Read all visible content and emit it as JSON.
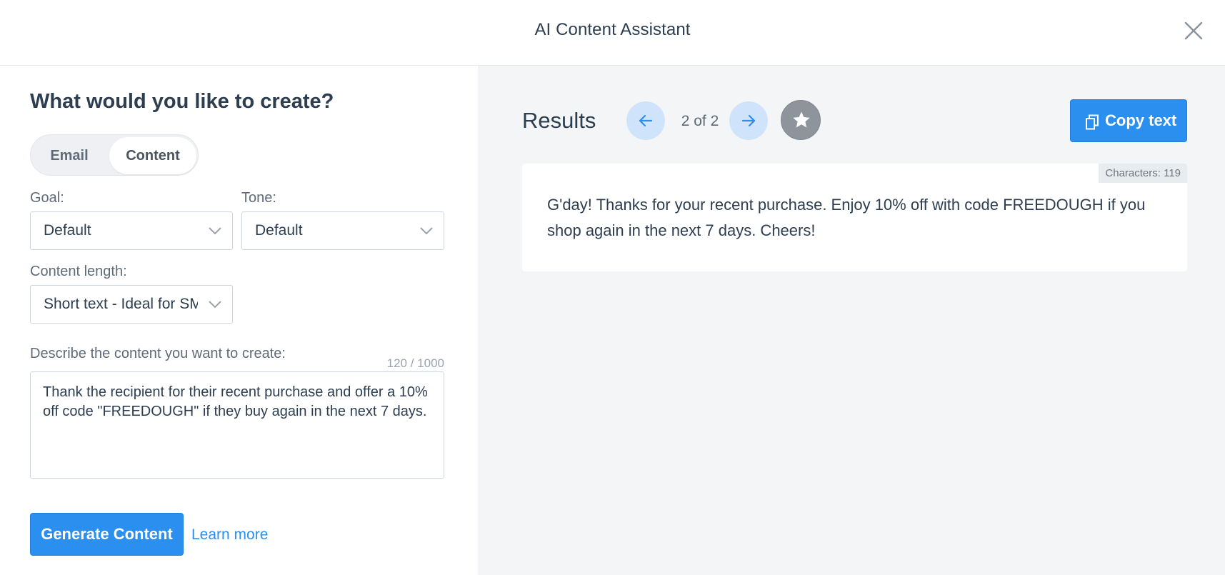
{
  "header": {
    "title": "AI Content Assistant"
  },
  "form": {
    "heading": "What would you like to create?",
    "toggle": {
      "options": [
        "Email",
        "Content"
      ],
      "selected": "Content"
    },
    "goal": {
      "label": "Goal:",
      "value": "Default"
    },
    "tone": {
      "label": "Tone:",
      "value": "Default"
    },
    "length": {
      "label": "Content length:",
      "value": "Short text - Ideal for SMS"
    },
    "description": {
      "label": "Describe the content you want to create:",
      "counter": "120 / 1000",
      "value": "Thank the recipient for their recent purchase and offer a 10% off code \"FREEDOUGH\" if they buy again in the next 7 days."
    },
    "generate_label": "Generate Content",
    "learn_more_label": "Learn more"
  },
  "results": {
    "title": "Results",
    "pager": "2 of 2",
    "copy_label": "Copy text",
    "char_count": "Characters: 119",
    "text": "G'day! Thanks for your recent purchase. Enjoy 10% off with code FREEDOUGH if you shop again in the next 7 days. Cheers!"
  },
  "colors": {
    "accent": "#2b8fef",
    "nav_bg": "#cfe4fa",
    "star_bg": "#8e949c",
    "panel_bg": "#f4f5f7"
  },
  "icons": [
    "close-icon",
    "chevron-down-icon",
    "arrow-left-icon",
    "arrow-right-icon",
    "star-icon",
    "copy-icon"
  ]
}
